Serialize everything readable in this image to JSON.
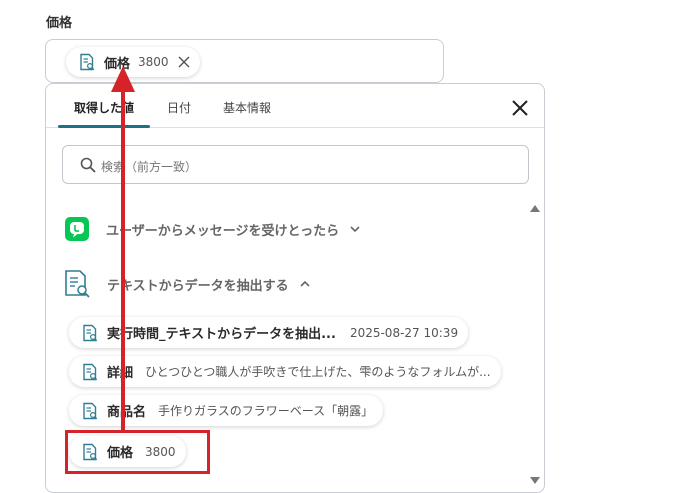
{
  "field": {
    "label": "価格",
    "selected_chip": {
      "name": "価格",
      "value": "3800"
    }
  },
  "tabs": [
    {
      "label": "取得した値",
      "active": true
    },
    {
      "label": "日付",
      "active": false
    },
    {
      "label": "基本情報",
      "active": false
    }
  ],
  "search": {
    "placeholder": "検索（前方一致）"
  },
  "sections": [
    {
      "label": "ユーザーからメッセージを受けとったら",
      "icon": "line-app-icon",
      "expanded": false
    },
    {
      "label": "テキストからデータを抽出する",
      "icon": "document-search-icon",
      "expanded": true
    }
  ],
  "items": [
    {
      "name": "実行時間_テキストからデータを抽出...",
      "value": "2025-08-27 10:39"
    },
    {
      "name": "詳細",
      "value": "ひとつひとつ職人が手吹きで仕上げた、雫のようなフォルムが..."
    },
    {
      "name": "商品名",
      "value": "手作りガラスのフラワーベース「朝露」"
    },
    {
      "name": "価格",
      "value": "3800"
    }
  ],
  "colors": {
    "accent_tab": "#1d6f8a",
    "annotation_red": "#d6232a",
    "line_green": "#06c755",
    "icon_teal": "#2f7f93"
  }
}
